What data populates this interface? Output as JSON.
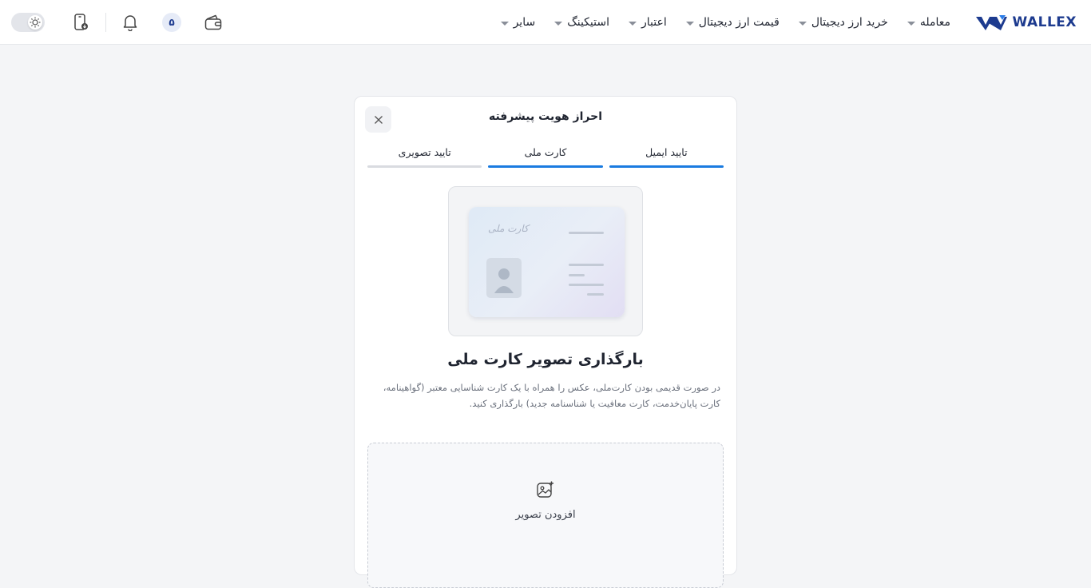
{
  "brand": {
    "name": "WALLEX",
    "logo_color": "#1d3b8f",
    "logo_accent": "#2b7de9"
  },
  "nav": {
    "items": [
      {
        "label": "معامله",
        "has_dropdown": true
      },
      {
        "label": "خرید ارز دیجیتال",
        "has_dropdown": true
      },
      {
        "label": "قیمت ارز دیجیتال",
        "has_dropdown": true
      },
      {
        "label": "اعتبار",
        "has_dropdown": true
      },
      {
        "label": "استیکینگ",
        "has_dropdown": true
      },
      {
        "label": "سایر",
        "has_dropdown": true
      }
    ]
  },
  "toolbar": {
    "theme_toggle_icon": "sun-icon",
    "app_icon": "mobile-download-icon",
    "notifications_icon": "bell-icon",
    "level_badge": "۵",
    "wallet_icon": "wallet-icon"
  },
  "verification": {
    "title": "احراز هویت پیشرفته",
    "close_icon": "close-icon",
    "steps": [
      {
        "label": "تایید ایمیل",
        "active": true
      },
      {
        "label": "کارت ملی",
        "active": true
      },
      {
        "label": "تایید تصویری",
        "active": false
      }
    ],
    "illustration": {
      "card_caption": "کارت ملی"
    },
    "upload_title": "بارگذاری تصویر کارت ملی",
    "upload_description": "در صورت قدیمی بودن کارت‌ملی، عکس را همراه با یک کارت شناسایی معتبر (گواهینامه، کارت پایان‌خدمت، کارت معافیت یا شناسنامه جدید) بارگذاری کنید.",
    "dropzone": {
      "icon": "add-image-icon",
      "label": "افزودن تصویر"
    }
  },
  "colors": {
    "accent": "#1a7be0",
    "background": "#f4f5f7",
    "inactive_step": "#d9dbe0"
  }
}
